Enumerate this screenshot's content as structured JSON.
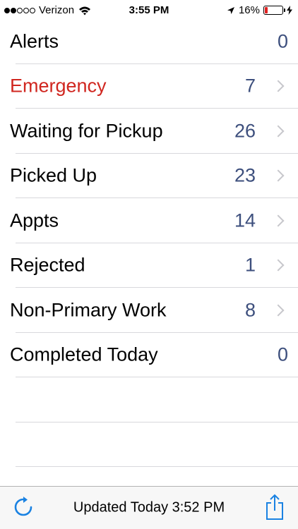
{
  "status_bar": {
    "carrier": "Verizon",
    "time": "3:55 PM",
    "battery_percent": "16%",
    "battery_level": 0.16,
    "icons": [
      "signal-dots-icon",
      "wifi-icon",
      "location-arrow-icon",
      "battery-icon",
      "charging-bolt-icon"
    ]
  },
  "list": {
    "rows": [
      {
        "label": "Alerts",
        "count": "0"
      },
      {
        "label": "Emergency",
        "count": "7"
      },
      {
        "label": "Waiting for Pickup",
        "count": "26"
      },
      {
        "label": "Picked Up",
        "count": "23"
      },
      {
        "label": "Appts",
        "count": "14"
      },
      {
        "label": "Rejected",
        "count": "1"
      },
      {
        "label": "Non-Primary Work",
        "count": "8"
      },
      {
        "label": "Completed Today",
        "count": "0"
      }
    ]
  },
  "toolbar": {
    "updated_text": "Updated Today 3:52 PM",
    "icons": [
      "refresh-icon",
      "share-icon"
    ]
  },
  "colors": {
    "accent": "#1a82e2",
    "emergency": "#d0261f",
    "count": "#3d4f7d",
    "battery_low": "#e02020"
  }
}
